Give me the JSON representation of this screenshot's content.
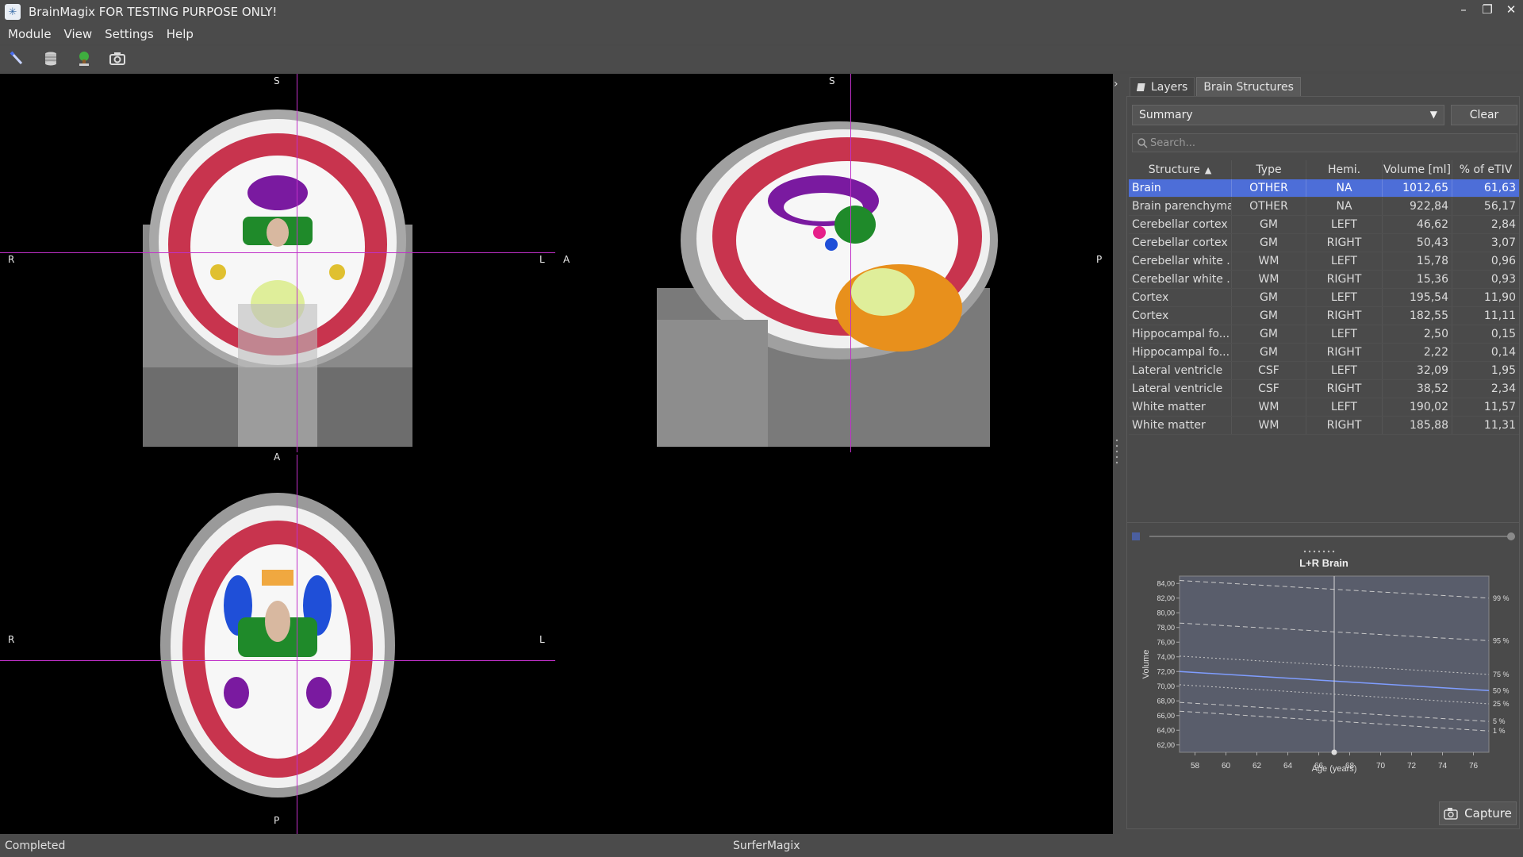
{
  "window": {
    "title": "BrainMagix FOR TESTING PURPOSE ONLY!",
    "controls": [
      "–",
      "❐",
      "✕"
    ]
  },
  "menu": [
    "Module",
    "View",
    "Settings",
    "Help"
  ],
  "toolbar": {
    "icons": [
      "brush-icon",
      "database-icon",
      "tree-icon",
      "camera-icon"
    ]
  },
  "viewer": {
    "coronal": {
      "top": "S",
      "bottom": "A",
      "left": "R",
      "right": "L"
    },
    "sagittal": {
      "top": "S",
      "left": "A",
      "right": "P"
    },
    "axial": {
      "bottom": "P",
      "left": "R",
      "right": "L"
    }
  },
  "tabs": [
    {
      "label": "Layers",
      "active": false
    },
    {
      "label": "Brain Structures",
      "active": true
    }
  ],
  "summary_select": "Summary",
  "clear_label": "Clear",
  "search_placeholder": "Search...",
  "table": {
    "columns": [
      "Structure",
      "Type",
      "Hemi.",
      "Volume [ml]",
      "% of eTIV"
    ],
    "rows": [
      [
        "Brain",
        "OTHER",
        "NA",
        "1012,65",
        "61,63"
      ],
      [
        "Brain parenchyma",
        "OTHER",
        "NA",
        "922,84",
        "56,17"
      ],
      [
        "Cerebellar cortex",
        "GM",
        "LEFT",
        "46,62",
        "2,84"
      ],
      [
        "Cerebellar cortex",
        "GM",
        "RIGHT",
        "50,43",
        "3,07"
      ],
      [
        "Cerebellar white ...",
        "WM",
        "LEFT",
        "15,78",
        "0,96"
      ],
      [
        "Cerebellar white ...",
        "WM",
        "RIGHT",
        "15,36",
        "0,93"
      ],
      [
        "Cortex",
        "GM",
        "LEFT",
        "195,54",
        "11,90"
      ],
      [
        "Cortex",
        "GM",
        "RIGHT",
        "182,55",
        "11,11"
      ],
      [
        "Hippocampal fo...",
        "GM",
        "LEFT",
        "2,50",
        "0,15"
      ],
      [
        "Hippocampal fo...",
        "GM",
        "RIGHT",
        "2,22",
        "0,14"
      ],
      [
        "Lateral ventricle",
        "CSF",
        "LEFT",
        "32,09",
        "1,95"
      ],
      [
        "Lateral ventricle",
        "CSF",
        "RIGHT",
        "38,52",
        "2,34"
      ],
      [
        "White matter",
        "WM",
        "LEFT",
        "190,02",
        "11,57"
      ],
      [
        "White matter",
        "WM",
        "RIGHT",
        "185,88",
        "11,31"
      ]
    ],
    "selected_row": 0
  },
  "chart_data": {
    "type": "line",
    "title": "L+R Brain",
    "xlabel": "Age (years)",
    "ylabel": "Volume",
    "xlim": [
      57,
      77
    ],
    "ylim": [
      61,
      85
    ],
    "xticks": [
      "58",
      "60",
      "62",
      "64",
      "66",
      "68",
      "70",
      "72",
      "74",
      "76"
    ],
    "yticks": [
      "62,00",
      "64,00",
      "66,00",
      "68,00",
      "70,00",
      "72,00",
      "74,00",
      "76,00",
      "78,00",
      "80,00",
      "82,00",
      "84,00"
    ],
    "cursor_x": 67,
    "series": [
      {
        "name": "99 %",
        "x": [
          57,
          77
        ],
        "y": [
          84.4,
          82.0
        ]
      },
      {
        "name": "95 %",
        "x": [
          57,
          77
        ],
        "y": [
          78.6,
          76.2
        ]
      },
      {
        "name": "75 %",
        "x": [
          57,
          77
        ],
        "y": [
          74.1,
          71.6
        ]
      },
      {
        "name": "50 %",
        "x": [
          57,
          77
        ],
        "y": [
          72.0,
          69.4
        ]
      },
      {
        "name": "25 %",
        "x": [
          57,
          77
        ],
        "y": [
          70.2,
          67.6
        ]
      },
      {
        "name": "5 %",
        "x": [
          57,
          77
        ],
        "y": [
          67.8,
          65.2
        ]
      },
      {
        "name": "1 %",
        "x": [
          57,
          77
        ],
        "y": [
          66.6,
          63.9
        ]
      }
    ]
  },
  "capture_label": "Capture",
  "status": {
    "left": "Completed",
    "center": "SurferMagix"
  }
}
